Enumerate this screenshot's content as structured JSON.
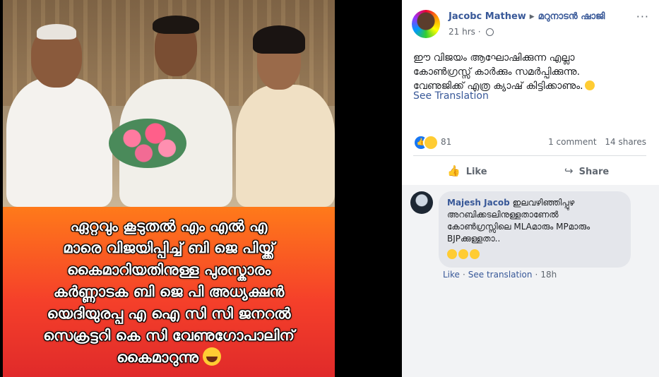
{
  "image_caption": {
    "lines": [
      "ഏറ്റവും കൂടുതൽ  എം എൽ എ",
      "മാരെ വിജയിപ്പിച്ച് ബി ജെ പിയ്ക്ക്",
      "കൈമാറിയതിനുള്ള പുരസ്കാരം",
      "കർണ്ണാടക ബി ജെ പി അധ്യക്ഷൻ",
      "യെദിയുരപ്പ എ ഐ സി സി ജനറൽ",
      "സെക്രട്ടറി കെ സി വേണുഗോപാലിന്",
      "കൈമാറുന്നു"
    ],
    "emoji_icon": "laughing-emoji"
  },
  "post": {
    "author": "Jacobc Mathew",
    "group": "മറുനാടൻ ഷാജി",
    "time": "21 hrs",
    "privacy_icon": "globe-icon",
    "more_label": "···",
    "text_lines": [
      "ഈ വിജയം ആഘോഷിക്കുന്ന എല്ലാ",
      "കോൺഗ്രസ്സ് കാർക്കും സമർപ്പിക്കുന്നു.",
      "വേണുജിക്ക് എത്ര ക്യാഷ് കിട്ടിക്കാണും."
    ],
    "see_translation": "See Translation"
  },
  "stats": {
    "reaction_count": "81",
    "comments": "1 comment",
    "shares": "14 shares"
  },
  "actions": {
    "like_label": "Like",
    "share_label": "Share"
  },
  "comment": {
    "author": "Majesh Jacob",
    "text_lines": [
      "ഇലവഴിഞ്ഞിപ്പുഴ",
      "അറബിക്കടലിനുള്ളതാണേൽ",
      "കോൺഗ്രസ്സിലെ MLAമാരും MPമാരും",
      "BJPക്കുള്ളതാ.."
    ],
    "like_label": "Like",
    "see_translation": "See translation",
    "time": "18h"
  },
  "colors": {
    "link": "#385898",
    "secondary_text": "#606770",
    "caption_gradient_top": "#ff7a1a",
    "caption_gradient_bottom": "#e02a2a"
  }
}
